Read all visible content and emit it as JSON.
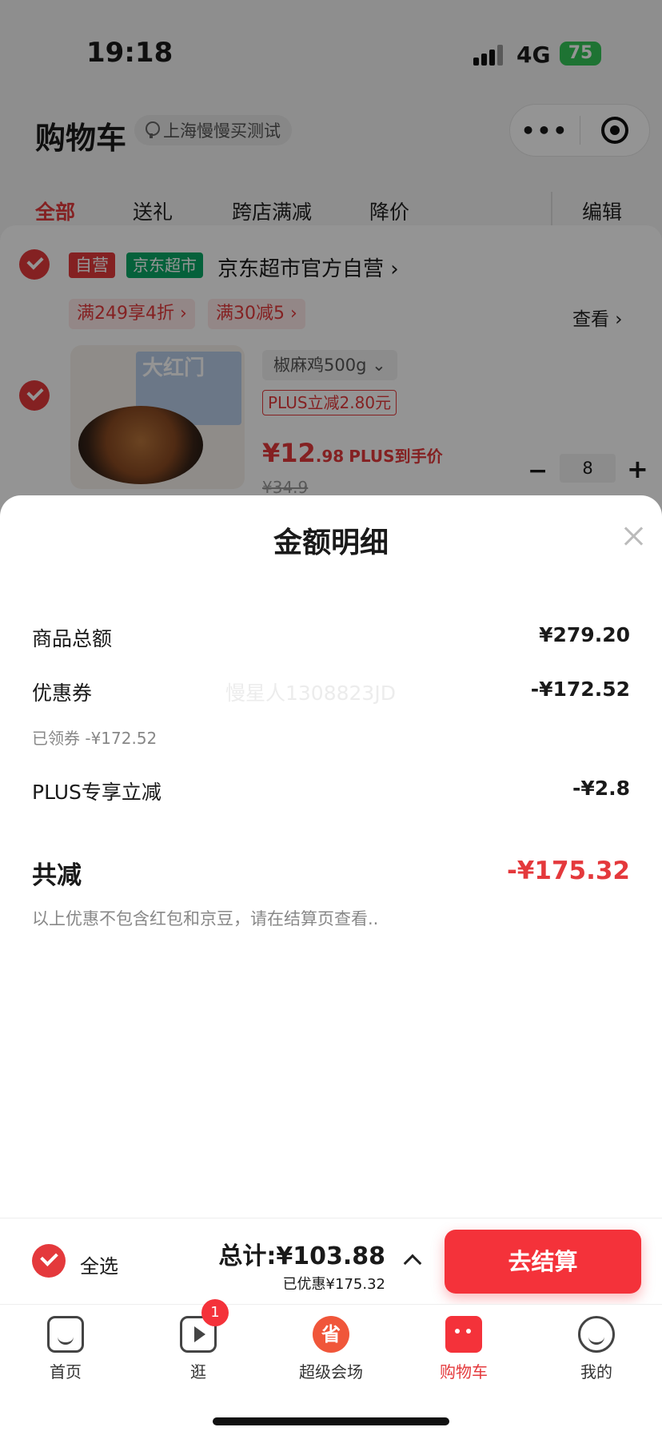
{
  "status": {
    "time": "19:18",
    "network": "4G",
    "battery": "75"
  },
  "header": {
    "title": "购物车",
    "location": "上海慢慢买测试"
  },
  "tabs": [
    {
      "label": "全部"
    },
    {
      "label": "送礼"
    },
    {
      "label": "跨店满减"
    },
    {
      "label": "降价"
    },
    {
      "label": "编辑"
    }
  ],
  "store": {
    "badge_self": "自营",
    "badge_market": "京东超市",
    "name": "京东超市官方自营 ›",
    "promo1": "满249享4折 ›",
    "promo2": "满30减5 ›",
    "view": "查看 ›"
  },
  "product": {
    "image_text": "大红门",
    "sku": "椒麻鸡500g ⌄",
    "plus_tag": "PLUS立减2.80元",
    "price_int": "¥12",
    "price_dec": ".98",
    "price_note": "PLUS到手价",
    "price_old": "¥34.9",
    "qty_minus": "−",
    "qty": "8",
    "qty_plus": "+"
  },
  "sheet": {
    "title": "金额明细",
    "rows": [
      {
        "label": "商品总额",
        "value": "¥279.20"
      },
      {
        "label": "优惠券",
        "value": "-¥172.52",
        "sub": "已领券 -¥172.52"
      },
      {
        "label": "PLUS专享立减",
        "value": "-¥2.8"
      }
    ],
    "watermark": "慢星人1308823JD",
    "total_label": "共减",
    "total_value": "-¥175.32",
    "note": "以上优惠不包含红包和京豆，请在结算页查看.."
  },
  "checkout": {
    "select_all": "全选",
    "total": "总计:¥103.88",
    "saved": "已优惠¥175.32",
    "button": "去结算"
  },
  "tabbar": {
    "items": [
      {
        "label": "首页",
        "icon": "home-icon"
      },
      {
        "label": "逛",
        "icon": "video-icon",
        "badge": "1"
      },
      {
        "label": "超级会场",
        "icon": "sale-icon",
        "glyph": "省"
      },
      {
        "label": "购物车",
        "icon": "cart-icon"
      },
      {
        "label": "我的",
        "icon": "profile-icon"
      }
    ]
  },
  "colors": {
    "accent": "#e4393c",
    "button": "#f4323a",
    "market_green": "#0aa866"
  }
}
